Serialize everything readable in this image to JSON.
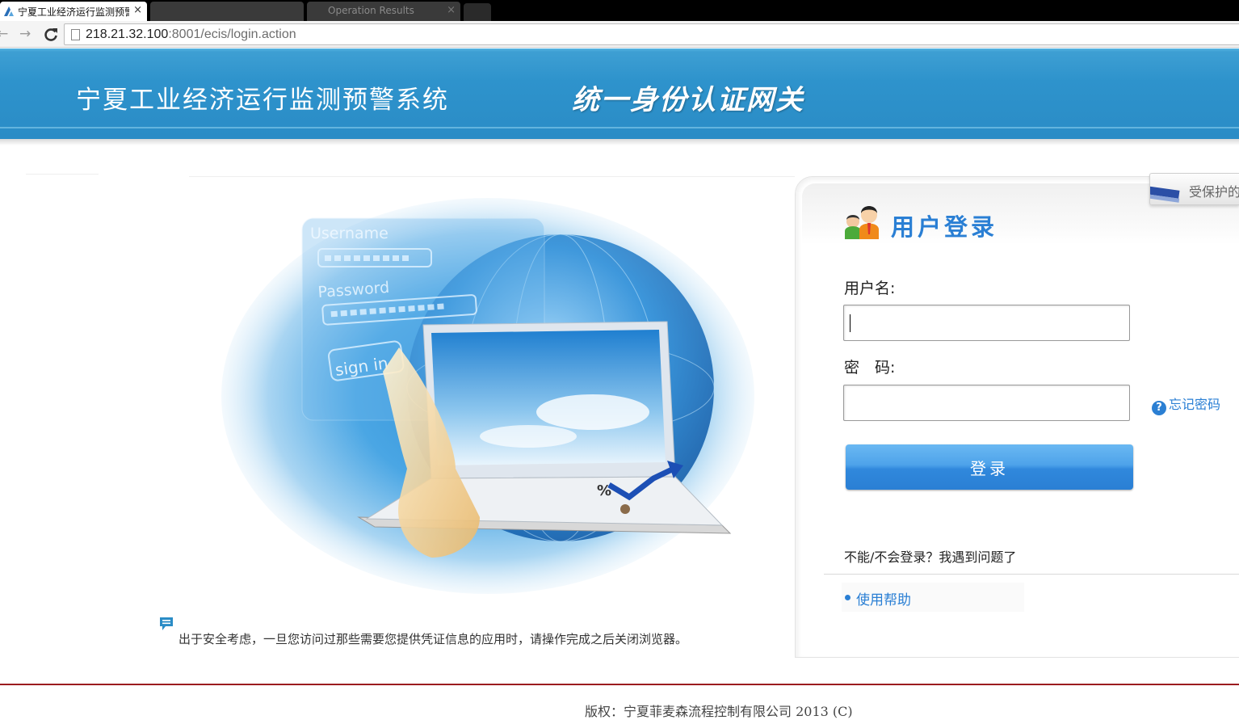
{
  "browser": {
    "tabs": [
      {
        "title": "宁夏工业经济运行监测预警",
        "close_glyph": "×"
      },
      {
        "title": ""
      },
      {
        "title": "Operation Results",
        "close_glyph": "×"
      }
    ],
    "url_host": "218.21.32.100",
    "url_rest": ":8001/ecis/login.action"
  },
  "header": {
    "system_title": "宁夏工业经济运行监测预警系统",
    "gateway_title": "统一身份认证网关"
  },
  "hero": {
    "username_label": "Username",
    "password_label": "Password",
    "signin_label": "sign in",
    "percent_glyph": "%"
  },
  "notice": {
    "text": "出于安全考虑，一旦您访问过那些需要您提供凭证信息的应用时，请操作完成之后关闭浏览器。"
  },
  "login": {
    "title": "用户登录",
    "username_label": "用户名:",
    "username_value": "",
    "password_label": "密　码:",
    "password_value": "",
    "forgot_label": "忘记密码",
    "forgot_glyph": "?",
    "submit_label": "登录",
    "trouble_text": "不能/不会登录？我遇到问题了",
    "help_link": "使用帮助"
  },
  "protected_tab": {
    "label": "受保护的"
  },
  "footer": {
    "copyright": "版权：宁夏菲麦森流程控制有限公司 2013 (C)"
  },
  "colors": {
    "header_blue": "#2e93cc",
    "link_blue": "#2a7fd4",
    "footer_rule": "#9b1b1f"
  }
}
